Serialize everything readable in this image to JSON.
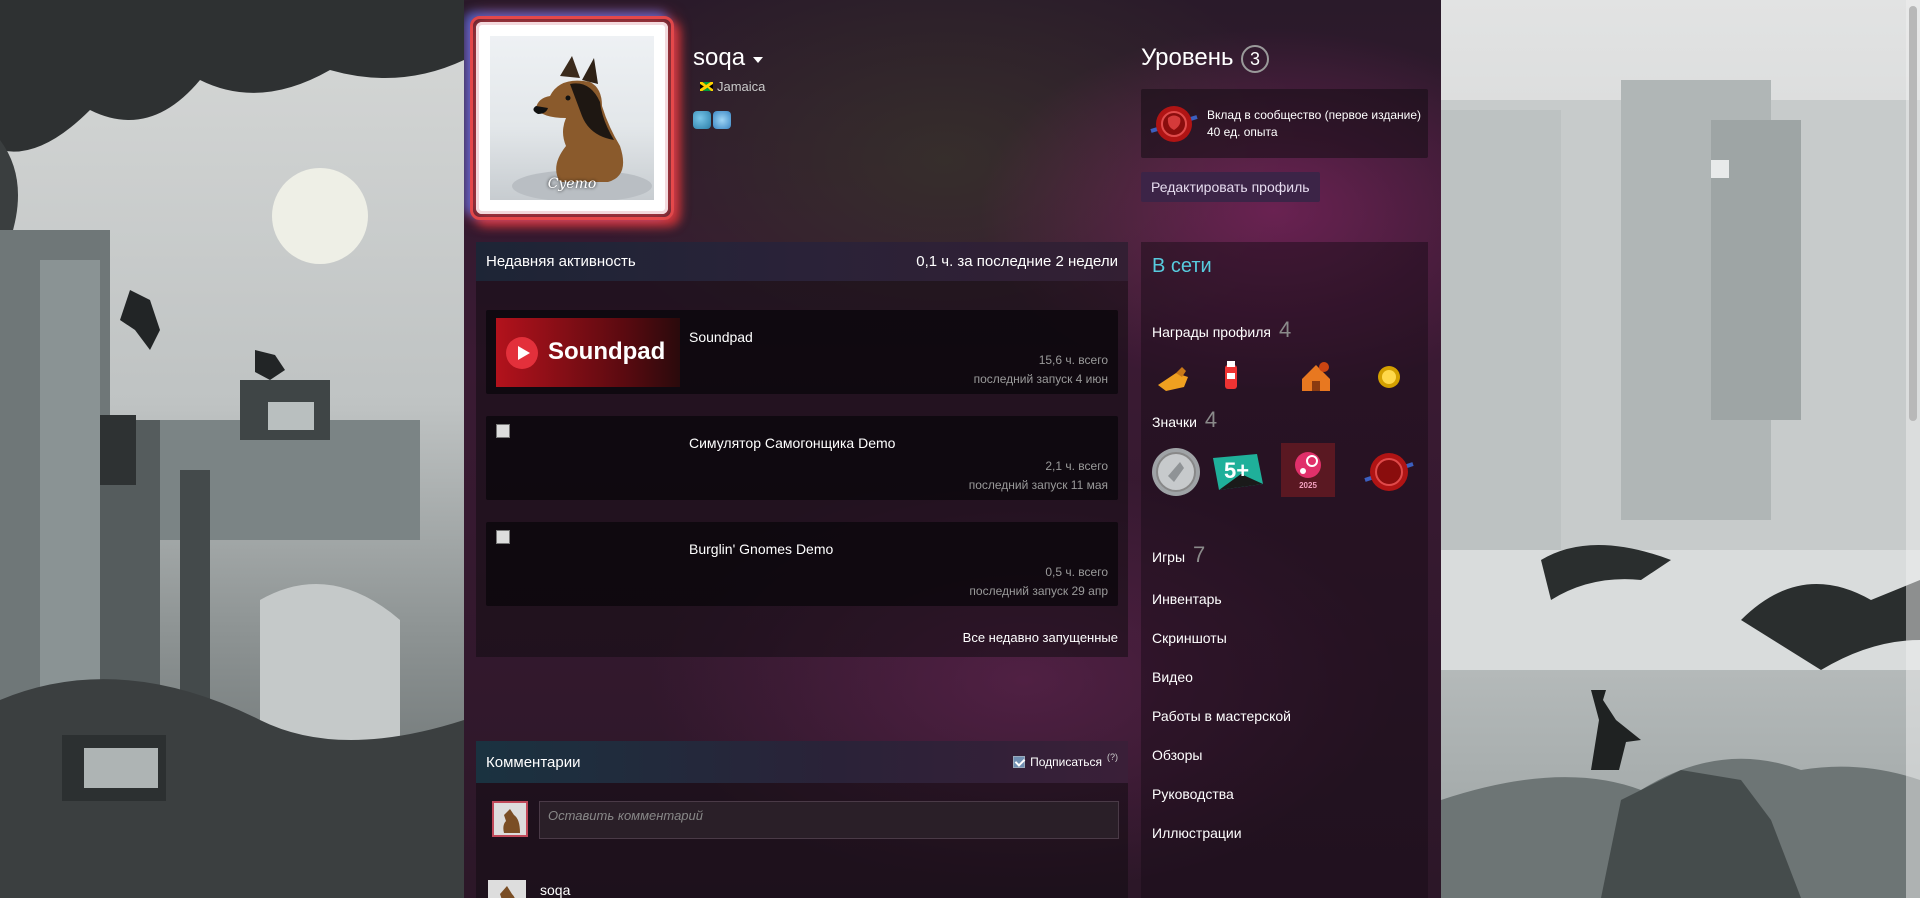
{
  "profile": {
    "name": "soqa",
    "location": "Jamaica",
    "avatar_signature": "Cyemo"
  },
  "level": {
    "label": "Уровень",
    "value": "3",
    "badge_title": "Вклад в сообщество (первое издание)",
    "badge_xp": "40 ед. опыта",
    "edit_button": "Редактировать профиль"
  },
  "activity": {
    "title": "Недавняя активность",
    "summary": "0,1 ч. за последние 2 недели",
    "games": [
      {
        "name": "Soundpad",
        "hours": "15,6 ч. всего",
        "last": "последний запуск 4 июн",
        "logo": "Soundpad"
      },
      {
        "name": "Симулятор Самогонщика Demo",
        "hours": "2,1 ч. всего",
        "last": "последний запуск 11 мая"
      },
      {
        "name": "Burglin' Gnomes Demo",
        "hours": "0,5 ч. всего",
        "last": "последний запуск 29 апр"
      }
    ],
    "all_recent": "Все недавно запущенные"
  },
  "comments": {
    "title": "Комментарии",
    "subscribe": "Подписаться",
    "help": "(?)",
    "placeholder": "Оставить комментарий",
    "first_author": "soqa"
  },
  "sidebar": {
    "status": "В сети",
    "awards_label": "Награды профиля",
    "awards_count": "4",
    "badges_label": "Значки",
    "badges_count": "4",
    "badge_5plus": "5+",
    "badge_2025": "2025",
    "games_label": "Игры",
    "games_count": "7",
    "links": [
      "Инвентарь",
      "Скриншоты",
      "Видео",
      "Работы в мастерской",
      "Обзоры",
      "Руководства",
      "Иллюстрации"
    ]
  },
  "colors": {
    "online": "#57cbde",
    "accent": "#3c2447"
  }
}
